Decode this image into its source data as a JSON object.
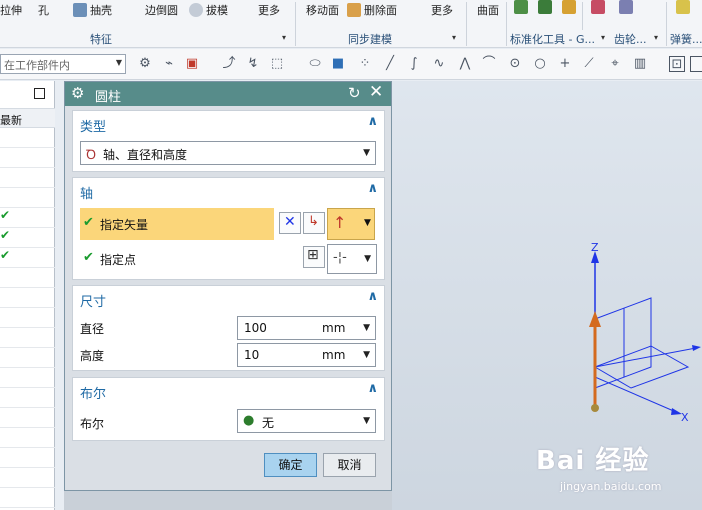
{
  "ribbon": {
    "items": {
      "extrude": "拉伸",
      "hole": "孔",
      "shell": "抽壳",
      "edge_blend": "边倒圆",
      "draft": "拔模",
      "more1": "更多",
      "move_face": "移动面",
      "delete_face": "删除面",
      "more2": "更多",
      "surface": "曲面"
    },
    "groups": {
      "feature": "特征",
      "sync_modeling": "同步建模",
      "standard_tools": "标准化工具 - G...",
      "gear": "齿轮...",
      "spring": "弹簧..."
    }
  },
  "toolbar2": {
    "filter_placeholder": "在工作部件内"
  },
  "navigator": {
    "column_header": "最新",
    "checks": [
      "✔",
      "✔",
      "✔"
    ]
  },
  "dialog": {
    "title": "圆柱",
    "type_section": {
      "label": "类型",
      "selected": "轴、直径和高度"
    },
    "axis_section": {
      "label": "轴",
      "specify_vector": "指定矢量",
      "specify_point": "指定点"
    },
    "dimension_section": {
      "label": "尺寸",
      "diameter_label": "直径",
      "diameter_value": "100",
      "diameter_unit": "mm",
      "height_label": "高度",
      "height_value": "10",
      "height_unit": "mm"
    },
    "boolean_section": {
      "label": "布尔",
      "field_label": "布尔",
      "selected": "无"
    },
    "ok_label": "确定",
    "cancel_label": "取消"
  },
  "viewport": {
    "z_axis_label": "Z",
    "x_axis_label": "X"
  },
  "watermark": {
    "brand": "Bai 经验",
    "url": "jingyan.baidu.com"
  },
  "colors": {
    "dialog_title_bg": "#578c8a",
    "section_label": "#1f6aa5",
    "highlight": "#fbd67a",
    "vector_orange": "#d46a1e",
    "axis_blue": "#1f35e6"
  }
}
